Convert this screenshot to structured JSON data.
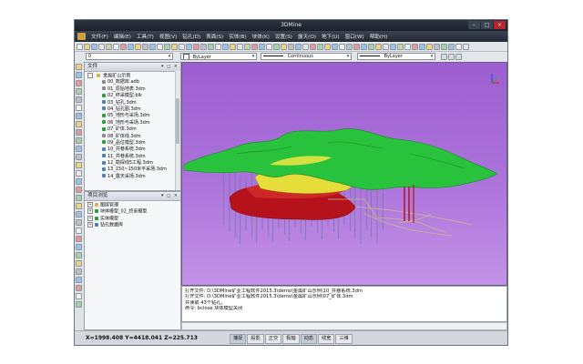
{
  "window": {
    "title": "3DMine"
  },
  "menu": [
    "文件(F)",
    "编辑(E)",
    "工具(T)",
    "视图(V)",
    "钻孔(D)",
    "表面(S)",
    "实体(B)",
    "块体(K)",
    "设置(S)",
    "露天(O)",
    "地下(U)",
    "窗口(W)",
    "帮助(H)"
  ],
  "toolbar": {
    "layer_combo": "0",
    "color_combo": "ByLayer",
    "linetype_combo": "Continuous",
    "lineweight_combo": "ByLayer"
  },
  "file_panel": {
    "title": "文件",
    "root": "金属矿山示例",
    "items": [
      "00_数据库.adb",
      "01_原始地表.3dm",
      "02_终采模型.blk",
      "03_钻孔.3dm",
      "04_钻孔图.3dm",
      "05_地形与采场.3dm",
      "06_地形与采场.3dm",
      "07_矿体.3dm",
      "08_矿体线.3dm",
      "09_品位模型.3dm",
      "10_井巷系统.3dm",
      "11_井巷系统.3dm",
      "12_勘探线5工程.3dm",
      "13_150~150米平采场.3dm",
      "14_露天采场.3dm"
    ]
  },
  "project_panel": {
    "title": "项目浏览",
    "items": [
      "图层管理",
      "块体模型_02_终采模型",
      "实体模型",
      "钻孔数据库"
    ]
  },
  "command_log": [
    "打开文件: D:\\3DMine矿业工程软件2015.3\\demo\\金属矿山示例\\10_井巷系统.3dm",
    "打开文件: D:\\3DMine矿业工程软件2015.3\\demo\\金属矿山示例\\07_矿体.3dm",
    "共读取 43个钻孔。",
    "命令: bclose 块体模型关闭"
  ],
  "status": {
    "coords": "X=1998.408 Y=4418.041 Z=225.713",
    "buttons": [
      "捕捉",
      "投影",
      "正交",
      "极轴",
      "动态",
      "线宽",
      "三维"
    ]
  }
}
